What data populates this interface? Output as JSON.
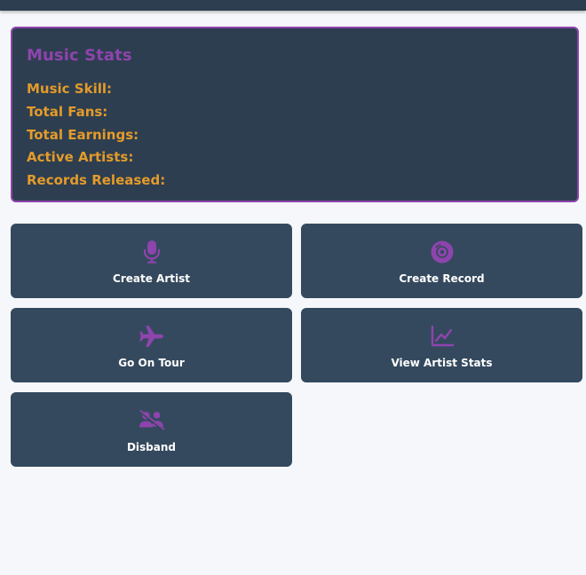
{
  "stats": {
    "title": "Music Stats",
    "rows": [
      {
        "label": "Music Skill:",
        "value": ""
      },
      {
        "label": "Total Fans:",
        "value": ""
      },
      {
        "label": "Total Earnings:",
        "value": ""
      },
      {
        "label": "Active Artists:",
        "value": ""
      },
      {
        "label": "Records Released:",
        "value": ""
      }
    ]
  },
  "actions": [
    {
      "label": "Create Artist",
      "icon": "microphone-icon"
    },
    {
      "label": "Create Record",
      "icon": "record-disc-icon"
    },
    {
      "label": "Go On Tour",
      "icon": "airplane-icon"
    },
    {
      "label": "View Artist Stats",
      "icon": "line-chart-icon"
    },
    {
      "label": "Disband",
      "icon": "users-slash-icon"
    }
  ],
  "colors": {
    "accent": "#8e44ad",
    "stat_text": "#e39b2a",
    "panel_bg": "#2d3e50",
    "button_bg": "#34495e",
    "page_bg": "#f5f7fa"
  }
}
